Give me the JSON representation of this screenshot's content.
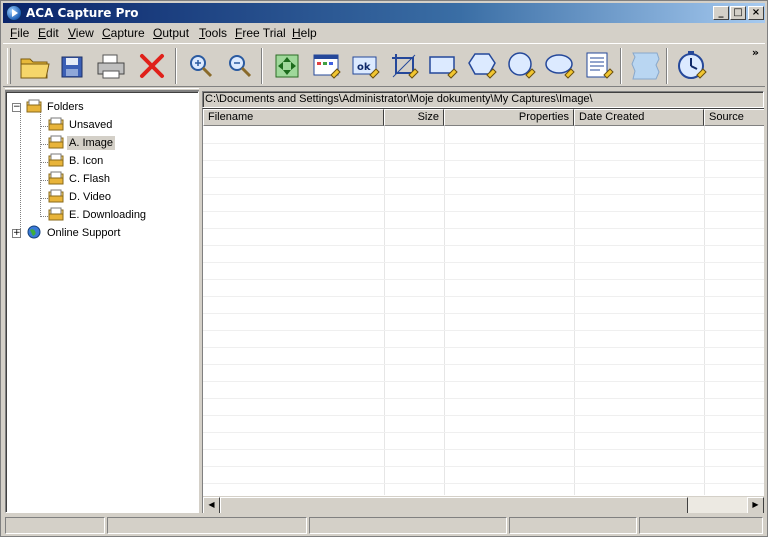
{
  "window": {
    "title": "ACA Capture Pro",
    "controls": {
      "minimize": "_",
      "maximize": "□",
      "close": "×"
    }
  },
  "menu": [
    {
      "label": "File",
      "accel": "F",
      "rest": "ile"
    },
    {
      "label": "Edit",
      "accel": "E",
      "rest": "dit"
    },
    {
      "label": "View",
      "accel": "V",
      "rest": "iew"
    },
    {
      "label": "Capture",
      "accel": "C",
      "rest": "apture"
    },
    {
      "label": "Output",
      "accel": "O",
      "rest": "utput"
    },
    {
      "label": "Tools",
      "accel": "T",
      "rest": "ools"
    },
    {
      "label": "Free Trial",
      "accel": "F",
      "rest": "ree Trial"
    },
    {
      "label": "Help",
      "accel": "H",
      "rest": "elp"
    }
  ],
  "toolbar": {
    "overflow": "»",
    "tools": [
      "open-folder-icon",
      "save-icon",
      "print-icon",
      "delete-icon",
      "zoom-in-icon",
      "zoom-out-icon",
      "capture-move-icon",
      "capture-window-icon",
      "capture-ok-icon",
      "capture-region-icon",
      "capture-rectangle-icon",
      "capture-polygon-icon",
      "capture-ellipse-icon",
      "capture-rounded-icon",
      "capture-scroll-icon",
      "capture-freehand-icon",
      "timer-icon"
    ]
  },
  "tree": {
    "root": "Folders",
    "folders": [
      "Unsaved",
      "A. Image",
      "B. Icon",
      "C. Flash",
      "D. Video",
      "E. Downloading"
    ],
    "selected": "A. Image",
    "other": "Online Support",
    "expand_minus": "−",
    "expand_plus": "+"
  },
  "path": "C:\\Documents and Settings\\Administrator\\Moje dokumenty\\My Captures\\Image\\",
  "list": {
    "columns": [
      "Filename",
      "Size",
      "Properties",
      "Date Created",
      "Source"
    ],
    "rows": []
  },
  "scroll": {
    "left": "◀",
    "right": "▶"
  },
  "colors": {
    "titlebar_start": "#0a246a",
    "titlebar_end": "#a6caf0",
    "face": "#d4d0c8"
  }
}
